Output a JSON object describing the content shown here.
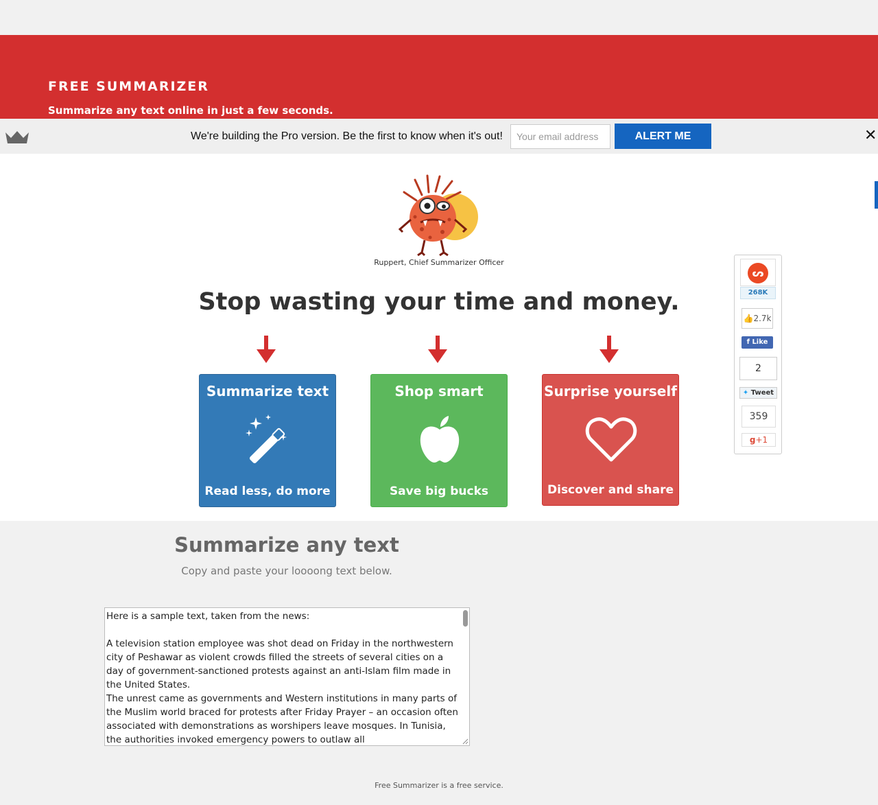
{
  "header": {
    "brand": "FREE SUMMARIZER",
    "tagline": "Summarize any text online in just a few seconds."
  },
  "pro_bar": {
    "message": "We're building the Pro version. Be the first to know when it's out!",
    "email_placeholder": "Your email address",
    "button_label": "ALERT ME",
    "close_label": "✕"
  },
  "hero": {
    "mascot_caption": "Ruppert, Chief Summarizer Officer",
    "headline": "Stop wasting your time and money."
  },
  "cards": [
    {
      "title": "Summarize text",
      "subtitle": "Read less, do more",
      "icon": "magic-wand-icon",
      "color": "#337ab7"
    },
    {
      "title": "Shop smart",
      "subtitle": "Save big bucks",
      "icon": "apple-icon",
      "color": "#5cb85c"
    },
    {
      "title": "Surprise yourself",
      "subtitle": "Discover and share",
      "icon": "heart-icon",
      "color": "#d9534f"
    }
  ],
  "share": {
    "stumbleupon_count": "268K",
    "facebook_count": "2.7k",
    "facebook_label": "Like",
    "twitter_count": "2",
    "twitter_label": "Tweet",
    "gplus_count": "359",
    "gplus_label": "+1"
  },
  "summarize": {
    "title": "Summarize any text",
    "subtitle": "Copy and paste your loooong text below.",
    "sample_text": "Here is a sample text, taken from the news:\n\nA television station employee was shot dead on Friday in the northwestern city of Peshawar as violent crowds filled the streets of several cities on a day of government-sanctioned protests against an anti-Islam film made in the United States.\nThe unrest came as governments and Western institutions in many parts of the Muslim world braced for protests after Friday Prayer – an occasion often associated with demonstrations as worshipers leave mosques. In Tunisia, the authorities invoked emergency powers to outlaw all"
  },
  "footer": {
    "text": "Free Summarizer is a free service."
  }
}
